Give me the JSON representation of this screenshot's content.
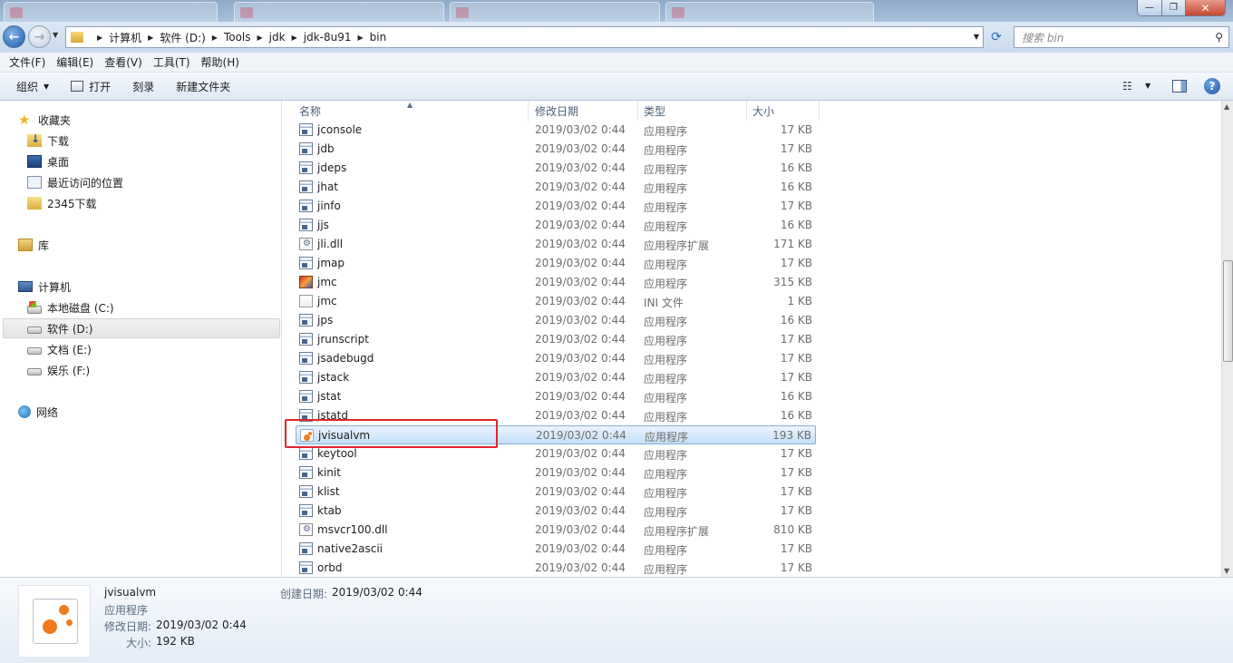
{
  "window": {
    "background_tabs": [
      "",
      "",
      "",
      ""
    ]
  },
  "address": {
    "crumbs": [
      "计算机",
      "软件 (D:)",
      "Tools",
      "jdk",
      "jdk-8u91",
      "bin"
    ],
    "search_placeholder": "搜索 bin"
  },
  "menu": [
    "文件(F)",
    "编辑(E)",
    "查看(V)",
    "工具(T)",
    "帮助(H)"
  ],
  "toolbar": {
    "organize": "组织",
    "open": "打开",
    "burn": "刻录",
    "new_folder": "新建文件夹"
  },
  "nav": {
    "favorites": "收藏夹",
    "downloads": "下载",
    "desktop": "桌面",
    "recent": "最近访问的位置",
    "dl2345": "2345下载",
    "libraries": "库",
    "computer": "计算机",
    "drive_c": "本地磁盘 (C:)",
    "drive_d": "软件 (D:)",
    "drive_e": "文档 (E:)",
    "drive_f": "娱乐 (F:)",
    "network": "网络"
  },
  "columns": {
    "name": "名称",
    "date": "修改日期",
    "type": "类型",
    "size": "大小"
  },
  "files": [
    {
      "name": "jconsole",
      "date": "2019/03/02 0:44",
      "type": "应用程序",
      "size": "17 KB",
      "icon": "exe-icon"
    },
    {
      "name": "jdb",
      "date": "2019/03/02 0:44",
      "type": "应用程序",
      "size": "17 KB",
      "icon": "exe-icon"
    },
    {
      "name": "jdeps",
      "date": "2019/03/02 0:44",
      "type": "应用程序",
      "size": "16 KB",
      "icon": "exe-icon"
    },
    {
      "name": "jhat",
      "date": "2019/03/02 0:44",
      "type": "应用程序",
      "size": "16 KB",
      "icon": "exe-icon"
    },
    {
      "name": "jinfo",
      "date": "2019/03/02 0:44",
      "type": "应用程序",
      "size": "17 KB",
      "icon": "exe-icon"
    },
    {
      "name": "jjs",
      "date": "2019/03/02 0:44",
      "type": "应用程序",
      "size": "16 KB",
      "icon": "exe-icon"
    },
    {
      "name": "jli.dll",
      "date": "2019/03/02 0:44",
      "type": "应用程序扩展",
      "size": "171 KB",
      "icon": "dll-icon"
    },
    {
      "name": "jmap",
      "date": "2019/03/02 0:44",
      "type": "应用程序",
      "size": "17 KB",
      "icon": "exe-icon"
    },
    {
      "name": "jmc",
      "date": "2019/03/02 0:44",
      "type": "应用程序",
      "size": "315 KB",
      "icon": "jmc-icon"
    },
    {
      "name": "jmc",
      "date": "2019/03/02 0:44",
      "type": "INI 文件",
      "size": "1 KB",
      "icon": "ini-file-icon"
    },
    {
      "name": "jps",
      "date": "2019/03/02 0:44",
      "type": "应用程序",
      "size": "16 KB",
      "icon": "exe-icon"
    },
    {
      "name": "jrunscript",
      "date": "2019/03/02 0:44",
      "type": "应用程序",
      "size": "17 KB",
      "icon": "exe-icon"
    },
    {
      "name": "jsadebugd",
      "date": "2019/03/02 0:44",
      "type": "应用程序",
      "size": "17 KB",
      "icon": "exe-icon"
    },
    {
      "name": "jstack",
      "date": "2019/03/02 0:44",
      "type": "应用程序",
      "size": "17 KB",
      "icon": "exe-icon"
    },
    {
      "name": "jstat",
      "date": "2019/03/02 0:44",
      "type": "应用程序",
      "size": "16 KB",
      "icon": "exe-icon"
    },
    {
      "name": "jstatd",
      "date": "2019/03/02 0:44",
      "type": "应用程序",
      "size": "16 KB",
      "icon": "exe-icon"
    },
    {
      "name": "jvisualvm",
      "date": "2019/03/02 0:44",
      "type": "应用程序",
      "size": "193 KB",
      "icon": "jvisualvm-icon",
      "selected": true
    },
    {
      "name": "keytool",
      "date": "2019/03/02 0:44",
      "type": "应用程序",
      "size": "17 KB",
      "icon": "exe-icon"
    },
    {
      "name": "kinit",
      "date": "2019/03/02 0:44",
      "type": "应用程序",
      "size": "17 KB",
      "icon": "exe-icon"
    },
    {
      "name": "klist",
      "date": "2019/03/02 0:44",
      "type": "应用程序",
      "size": "17 KB",
      "icon": "exe-icon"
    },
    {
      "name": "ktab",
      "date": "2019/03/02 0:44",
      "type": "应用程序",
      "size": "17 KB",
      "icon": "exe-icon"
    },
    {
      "name": "msvcr100.dll",
      "date": "2019/03/02 0:44",
      "type": "应用程序扩展",
      "size": "810 KB",
      "icon": "dll-icon"
    },
    {
      "name": "native2ascii",
      "date": "2019/03/02 0:44",
      "type": "应用程序",
      "size": "17 KB",
      "icon": "exe-icon"
    },
    {
      "name": "orbd",
      "date": "2019/03/02 0:44",
      "type": "应用程序",
      "size": "17 KB",
      "icon": "exe-icon"
    }
  ],
  "details": {
    "name": "jvisualvm",
    "type": "应用程序",
    "modified_label": "修改日期:",
    "modified_value": "2019/03/02 0:44",
    "size_label": "大小:",
    "size_value": "192 KB",
    "created_label": "创建日期:",
    "created_value": "2019/03/02 0:44"
  },
  "colors": {
    "highlight_border": "#e0242c",
    "selection_bg": "#c6dff7",
    "selection_border": "#84acdd"
  }
}
